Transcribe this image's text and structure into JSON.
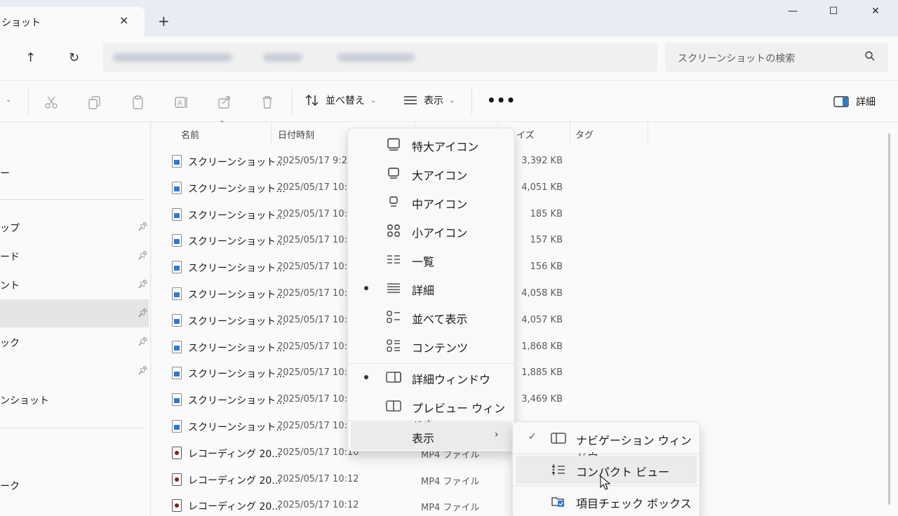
{
  "tab": {
    "title": "ショット",
    "close": "✕",
    "new": "+"
  },
  "window": {
    "minimize": "—",
    "maximize": "☐",
    "close": "✕"
  },
  "nav": {
    "up": "↑",
    "refresh": "↻",
    "search_placeholder": "スクリーンショットの検索"
  },
  "toolbar": {
    "new_chevron": "⌄",
    "sort_label": "並べ替え",
    "view_label": "表示",
    "more": "•••",
    "details_label": "詳細"
  },
  "sidebar": {
    "items": [
      {
        "label": "ー"
      },
      {
        "label": "ップ"
      },
      {
        "label": "ード"
      },
      {
        "label": "ント"
      },
      {
        "label": ""
      },
      {
        "label": "ック"
      },
      {
        "label": ""
      },
      {
        "label": "ンショット"
      },
      {
        "label": "ーク"
      }
    ]
  },
  "columns": {
    "name": "名前",
    "date": "日付時刻",
    "size": "イズ",
    "tags": "タグ"
  },
  "files": [
    {
      "name": "スクリーンショット...",
      "date": "2025/05/17 9:2",
      "type": "",
      "size": "3,392 KB",
      "kind": "png"
    },
    {
      "name": "スクリーンショット...",
      "date": "2025/05/17 10:",
      "type": "",
      "size": "4,051 KB",
      "kind": "png"
    },
    {
      "name": "スクリーンショット...",
      "date": "2025/05/17 10:",
      "type": "",
      "size": "185 KB",
      "kind": "png"
    },
    {
      "name": "スクリーンショット...",
      "date": "2025/05/17 10:",
      "type": "",
      "size": "157 KB",
      "kind": "png"
    },
    {
      "name": "スクリーンショット...",
      "date": "2025/05/17 10:",
      "type": "",
      "size": "156 KB",
      "kind": "png"
    },
    {
      "name": "スクリーンショット...",
      "date": "2025/05/17 10:",
      "type": "",
      "size": "4,058 KB",
      "kind": "png"
    },
    {
      "name": "スクリーンショット...",
      "date": "2025/05/17 10:",
      "type": "",
      "size": "4,057 KB",
      "kind": "png"
    },
    {
      "name": "スクリーンショット...",
      "date": "2025/05/17 10:",
      "type": "",
      "size": "1,868 KB",
      "kind": "png"
    },
    {
      "name": "スクリーンショット...",
      "date": "2025/05/17 10:",
      "type": "",
      "size": "1,885 KB",
      "kind": "png"
    },
    {
      "name": "スクリーンショット...",
      "date": "2025/05/17 10:",
      "type": "",
      "size": "3,469 KB",
      "kind": "png"
    },
    {
      "name": "スクリーンショット...",
      "date": "2025/05/17 10:",
      "type": "",
      "size": "",
      "kind": "png"
    },
    {
      "name": "レコーディング 20...",
      "date": "2025/05/17 10:10",
      "type": "MP4 ファイル",
      "size": "",
      "kind": "mp4"
    },
    {
      "name": "レコーディング 20...",
      "date": "2025/05/17 10:12",
      "type": "MP4 ファイル",
      "size": "",
      "kind": "mp4"
    },
    {
      "name": "レコーディング 20...",
      "date": "2025/05/17 10:12",
      "type": "MP4 ファイル",
      "size": "",
      "kind": "mp4"
    }
  ],
  "view_menu": {
    "items": [
      {
        "label": "特大アイコン",
        "icon": "extra-large-icons-icon"
      },
      {
        "label": "大アイコン",
        "icon": "large-icons-icon"
      },
      {
        "label": "中アイコン",
        "icon": "medium-icons-icon"
      },
      {
        "label": "小アイコン",
        "icon": "small-icons-icon"
      },
      {
        "label": "一覧",
        "icon": "list-icon"
      },
      {
        "label": "詳細",
        "icon": "details-icon",
        "selected": true
      },
      {
        "label": "並べて表示",
        "icon": "tiles-icon"
      },
      {
        "label": "コンテンツ",
        "icon": "content-icon"
      }
    ],
    "pane_items": [
      {
        "label": "詳細ウィンドウ",
        "icon": "details-pane-icon",
        "selected": true
      },
      {
        "label": "プレビュー ウィンドウ",
        "icon": "preview-pane-icon"
      }
    ],
    "show_label": "表示",
    "show_arrow": "›"
  },
  "show_submenu": {
    "check": "✓",
    "items": [
      {
        "label": "ナビゲーション ウィンドウ",
        "checked": true
      },
      {
        "label": "コンパクト ビュー"
      },
      {
        "label": "項目チェック ボックス"
      }
    ]
  }
}
